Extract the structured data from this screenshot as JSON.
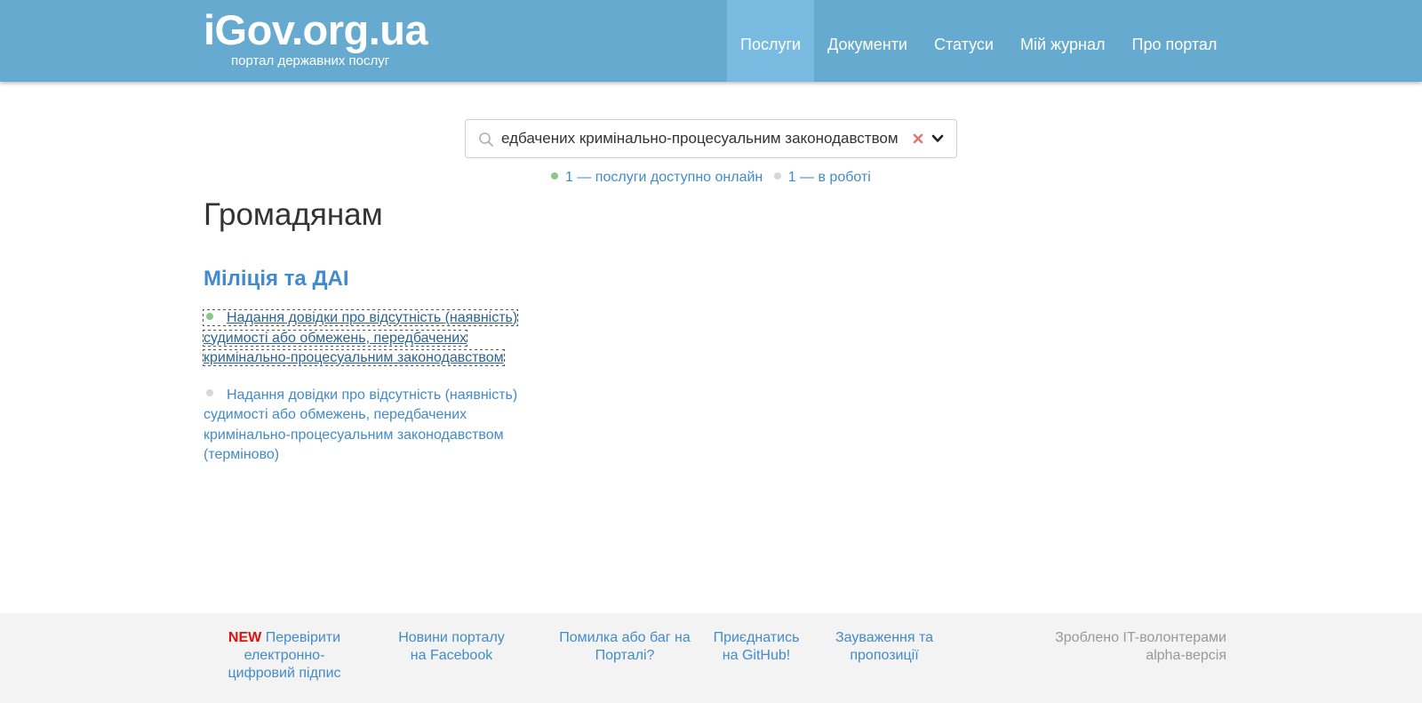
{
  "header": {
    "logo_title": "iGov.org.ua",
    "logo_subtitle": "портал державних послуг",
    "nav": [
      {
        "label": "Послуги",
        "active": true
      },
      {
        "label": "Документи",
        "active": false
      },
      {
        "label": "Статуси",
        "active": false
      },
      {
        "label": "Мій журнал",
        "active": false
      },
      {
        "label": "Про портал",
        "active": false
      }
    ]
  },
  "search": {
    "value": "едбачених кримінально-процесуальним законодавством",
    "icons": [
      "search-icon",
      "clear-icon",
      "chevron-down-icon"
    ]
  },
  "stats": {
    "online": "1 — послуги доступно онлайн",
    "in_progress": "1 — в роботі"
  },
  "page_title": "Громадянам",
  "category": "Міліція та ДАІ",
  "services": [
    {
      "label": "Надання довідки про відсутність (наявність) судимості або обмежень, передбачених кримінально-процесуальним законодавством",
      "status": "online"
    },
    {
      "label": "Надання довідки про відсутність (наявність) судимості або обмежень, передбачених кримінально-процесуальним законодавством (терміново)",
      "status": "in_progress"
    }
  ],
  "footer": {
    "new_badge": "NEW",
    "check_signature": "Перевірити електронно-цифровий підпис",
    "facebook": "Новини порталу на Facebook",
    "bug": "Помилка або баг на Порталі?",
    "github": "Приєднатись на GitHub!",
    "feedback": "Зауваження та пропозиції",
    "made_by": "Зроблено IT-волонтерами",
    "version": "alpha-версія"
  },
  "colors": {
    "header_bg": "#66aad0",
    "nav_active_bg": "#79bbe0",
    "link": "#428bca",
    "online_dot": "#8bc78a",
    "in_progress_dot": "#d8d8d8",
    "new_badge": "#e01010",
    "footer_bg": "#f3f3f3"
  }
}
